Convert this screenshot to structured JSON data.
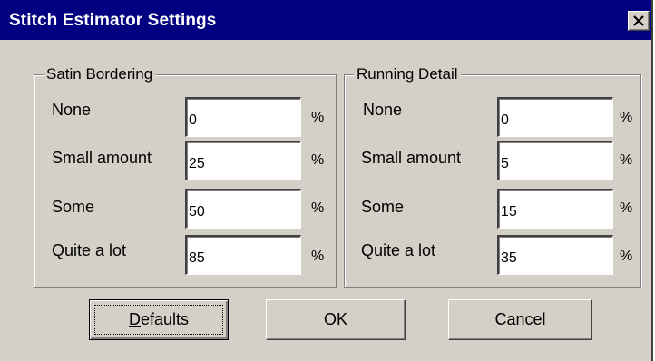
{
  "window": {
    "title": "Stitch Estimator Settings",
    "close_icon": "close-x-icon"
  },
  "satin_bordering": {
    "legend": "Satin Bordering",
    "rows": [
      {
        "label": "None",
        "value": "0",
        "unit": "%"
      },
      {
        "label": "Small amount",
        "value": "25",
        "unit": "%"
      },
      {
        "label": "Some",
        "value": "50",
        "unit": "%"
      },
      {
        "label": "Quite a lot",
        "value": "85",
        "unit": "%"
      }
    ]
  },
  "running_detail": {
    "legend": "Running Detail",
    "rows": [
      {
        "label": "None",
        "value": "0",
        "unit": "%"
      },
      {
        "label": "Small amount",
        "value": "5",
        "unit": "%"
      },
      {
        "label": "Some",
        "value": "15",
        "unit": "%"
      },
      {
        "label": "Quite a lot",
        "value": "35",
        "unit": "%"
      }
    ]
  },
  "buttons": {
    "defaults_mnemonic": "D",
    "defaults_rest": "efaults",
    "ok": "OK",
    "cancel": "Cancel"
  },
  "colors": {
    "titlebar": "#000080",
    "face": "#d4d0c8"
  }
}
